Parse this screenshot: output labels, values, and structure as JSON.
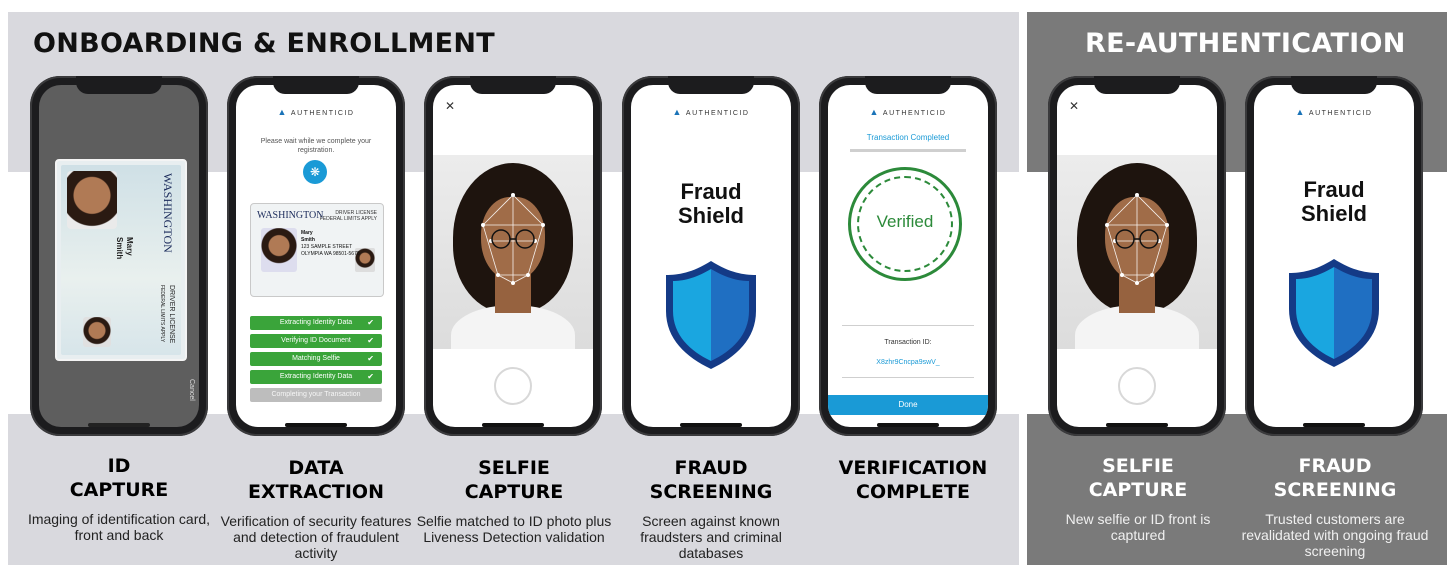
{
  "sections": {
    "onboarding_title": "ONBOARDING & ENROLLMENT",
    "reauth_title": "RE-AUTHENTICATION"
  },
  "colors": {
    "light_band": "#d9d9de",
    "dark_band": "#7a7a7a",
    "green": "#3aa43a",
    "blue": "#1a9ad6",
    "verified_green": "#2c8a3a"
  },
  "brand": {
    "logo_text": "AUTHENTICID"
  },
  "steps": [
    {
      "title_line1": "ID",
      "title_line2": "CAPTURE",
      "desc": "Imaging of identification card, front and back"
    },
    {
      "title_line1": "DATA",
      "title_line2": "EXTRACTION",
      "desc": "Verification of security features and detection of fraudulent activity"
    },
    {
      "title_line1": "SELFIE",
      "title_line2": "CAPTURE",
      "desc": "Selfie matched to ID photo plus Liveness Detection validation"
    },
    {
      "title_line1": "FRAUD",
      "title_line2": "SCREENING",
      "desc": "Screen against known fraudsters and criminal databases"
    },
    {
      "title_line1": "VERIFICATION",
      "title_line2": "COMPLETE",
      "desc": ""
    },
    {
      "title_line1": "SELFIE",
      "title_line2": "CAPTURE",
      "desc": "New selfie or ID front is captured"
    },
    {
      "title_line1": "FRAUD",
      "title_line2": "SCREENING",
      "desc": "Trusted customers are revalidated with ongoing fraud screening"
    }
  ],
  "id_capture": {
    "card_state": "WASHINGTON",
    "card_type": "DRIVER LICENSE",
    "card_sub": "FEDERAL LIMITS APPLY",
    "name_last": "Mary",
    "name_first": "Smith",
    "cancel_label": "Cancel"
  },
  "data_extraction": {
    "wait_message": "Please wait while we complete your registration.",
    "dl_state": "WASHINGTON",
    "dl_type": "DRIVER LICENSE",
    "dl_sub": "FEDERAL LIMITS APPLY",
    "dl_lines": [
      "Mary",
      "Smith",
      "123 SAMPLE STREET",
      "OLYMPIA WA 98501-5678"
    ],
    "statuses": [
      {
        "label": "Extracting Identity Data",
        "done": true
      },
      {
        "label": "Verifying ID Document",
        "done": true
      },
      {
        "label": "Matching Selfie",
        "done": true
      },
      {
        "label": "Extracting Identity Data",
        "done": true
      },
      {
        "label": "Completing your Transaction",
        "done": false
      }
    ]
  },
  "fraud_shield": {
    "line1": "Fraud",
    "line2": "Shield"
  },
  "verification": {
    "header": "Transaction Completed",
    "stamp": "Verified",
    "txn_label": "Transaction ID:",
    "txn_id": "X8zhr9Cncpa9swV_",
    "done_button": "Done"
  },
  "icons": {
    "close": "close-icon",
    "check": "check-icon",
    "spinner": "spinner-icon",
    "shutter": "shutter-button"
  }
}
